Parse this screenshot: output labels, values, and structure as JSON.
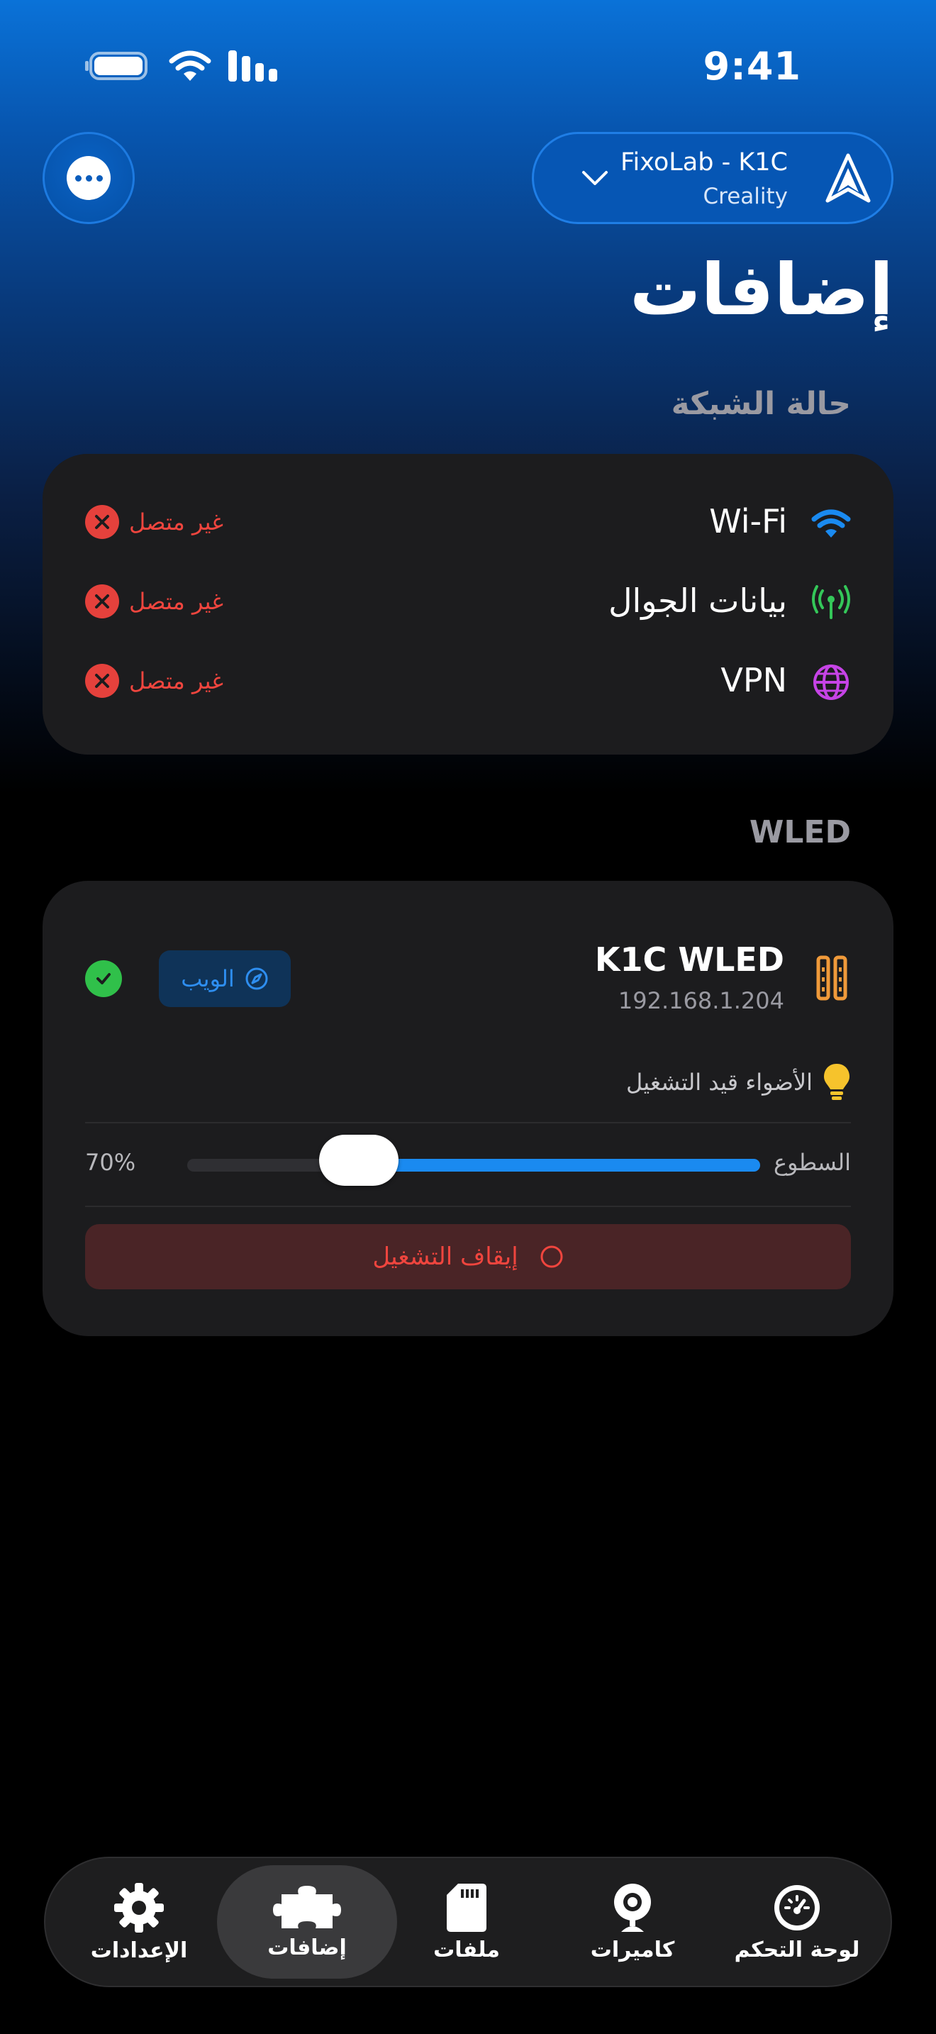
{
  "status_bar": {
    "time": "9:41"
  },
  "header": {
    "printer_name": "FixoLab - K1C",
    "printer_brand": "Creality",
    "title": "إضافات"
  },
  "network": {
    "section_label": "حالة الشبكة",
    "rows": [
      {
        "label": "Wi-Fi",
        "status": "غير متصل",
        "icon": "wifi-icon",
        "icon_color": "#1a8af0"
      },
      {
        "label": "بيانات الجوال",
        "status": "غير متصل",
        "icon": "antenna-icon",
        "icon_color": "#34c759"
      },
      {
        "label": "VPN",
        "status": "غير متصل",
        "icon": "globe-icon",
        "icon_color": "#c643e6"
      }
    ]
  },
  "wled": {
    "section_label": "WLED",
    "device_name": "K1C WLED",
    "device_ip": "192.168.1.204",
    "web_label": "الويب",
    "lights_status": "الأضواء قيد التشغيل",
    "brightness_label": "السطوع",
    "brightness_value": "70%",
    "brightness_level": 0.7,
    "stop_label": "إيقاف التشغيل"
  },
  "colors": {
    "accent": "#1a8af0",
    "error": "#f0453e",
    "success": "#30c04a",
    "wled_icon": "#f09a3a",
    "bulb": "#f6c32c"
  },
  "tabs": [
    {
      "label": "لوحة التحكم",
      "icon": "gauge-icon"
    },
    {
      "label": "كاميرات",
      "icon": "webcam-icon"
    },
    {
      "label": "ملفات",
      "icon": "sd-card-icon"
    },
    {
      "label": "إضافات",
      "icon": "puzzle-icon",
      "active": true
    },
    {
      "label": "الإعدادات",
      "icon": "gear-icon"
    }
  ]
}
